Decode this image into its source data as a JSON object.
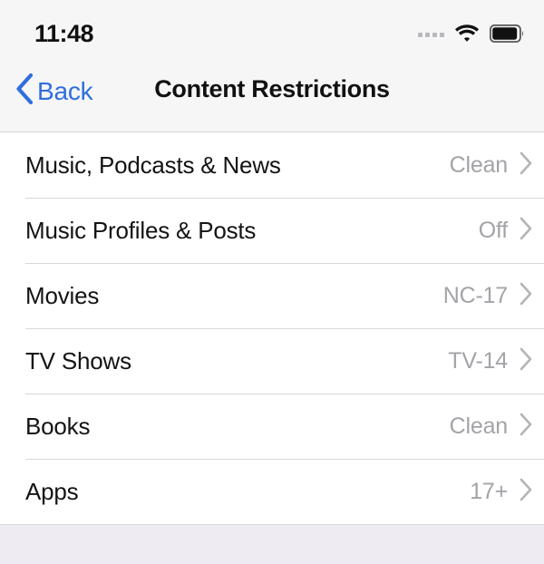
{
  "status_bar": {
    "time": "11:48",
    "signal_icon": "signal-dots-icon",
    "wifi_icon": "wifi-icon",
    "battery_icon": "battery-full-icon"
  },
  "nav_bar": {
    "back_label": "Back",
    "back_icon": "chevron-left-icon",
    "title": "Content Restrictions"
  },
  "list": {
    "rows": [
      {
        "label": "Music, Podcasts & News",
        "value": "Clean",
        "chevron": "chevron-right-icon"
      },
      {
        "label": "Music Profiles & Posts",
        "value": "Off",
        "chevron": "chevron-right-icon"
      },
      {
        "label": "Movies",
        "value": "NC-17",
        "chevron": "chevron-right-icon"
      },
      {
        "label": "TV Shows",
        "value": "TV-14",
        "chevron": "chevron-right-icon"
      },
      {
        "label": "Books",
        "value": "Clean",
        "chevron": "chevron-right-icon"
      },
      {
        "label": "Apps",
        "value": "17+",
        "chevron": "chevron-right-icon"
      }
    ]
  },
  "colors": {
    "accent_blue": "#2f6fdd",
    "header_background": "#f6f6f7",
    "list_background": "#ffffff",
    "footer_background": "#eeecf2",
    "value_gray": "#a3a3a8",
    "separator": "#d8d8da"
  }
}
